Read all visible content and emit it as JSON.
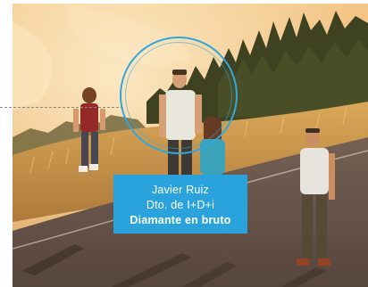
{
  "profile_card": {
    "name": "Javier Ruiz",
    "department": "Dto. de I+D+i",
    "tagline": "Diamante en bruto"
  },
  "colors": {
    "accent": "#2aa3dc",
    "ring": "#2fa7e0"
  },
  "photo": {
    "subject": "group-walking-on-road-photo"
  }
}
